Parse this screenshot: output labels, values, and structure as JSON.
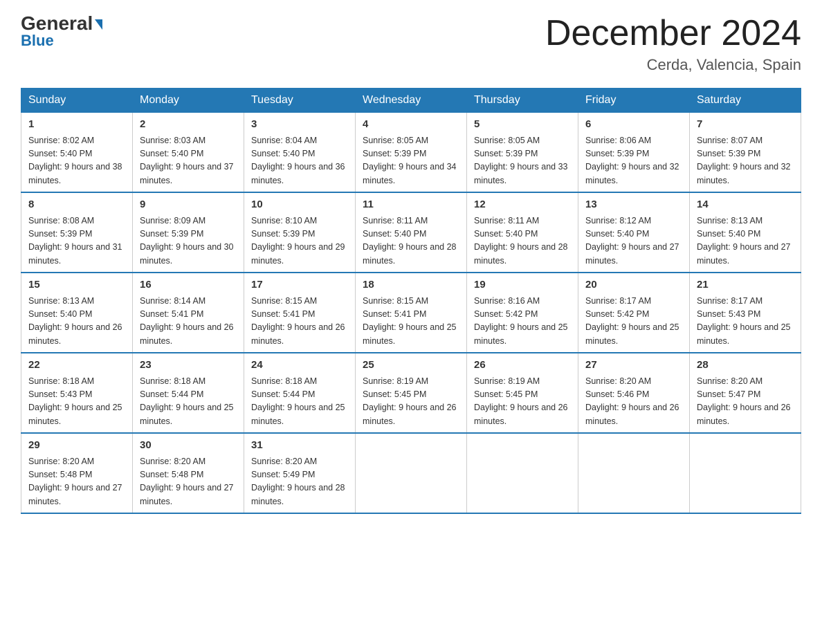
{
  "header": {
    "logo_top": "General",
    "logo_bottom": "Blue",
    "month_title": "December 2024",
    "location": "Cerda, Valencia, Spain"
  },
  "days_of_week": [
    "Sunday",
    "Monday",
    "Tuesday",
    "Wednesday",
    "Thursday",
    "Friday",
    "Saturday"
  ],
  "weeks": [
    [
      {
        "day": "1",
        "sunrise": "Sunrise: 8:02 AM",
        "sunset": "Sunset: 5:40 PM",
        "daylight": "Daylight: 9 hours and 38 minutes."
      },
      {
        "day": "2",
        "sunrise": "Sunrise: 8:03 AM",
        "sunset": "Sunset: 5:40 PM",
        "daylight": "Daylight: 9 hours and 37 minutes."
      },
      {
        "day": "3",
        "sunrise": "Sunrise: 8:04 AM",
        "sunset": "Sunset: 5:40 PM",
        "daylight": "Daylight: 9 hours and 36 minutes."
      },
      {
        "day": "4",
        "sunrise": "Sunrise: 8:05 AM",
        "sunset": "Sunset: 5:39 PM",
        "daylight": "Daylight: 9 hours and 34 minutes."
      },
      {
        "day": "5",
        "sunrise": "Sunrise: 8:05 AM",
        "sunset": "Sunset: 5:39 PM",
        "daylight": "Daylight: 9 hours and 33 minutes."
      },
      {
        "day": "6",
        "sunrise": "Sunrise: 8:06 AM",
        "sunset": "Sunset: 5:39 PM",
        "daylight": "Daylight: 9 hours and 32 minutes."
      },
      {
        "day": "7",
        "sunrise": "Sunrise: 8:07 AM",
        "sunset": "Sunset: 5:39 PM",
        "daylight": "Daylight: 9 hours and 32 minutes."
      }
    ],
    [
      {
        "day": "8",
        "sunrise": "Sunrise: 8:08 AM",
        "sunset": "Sunset: 5:39 PM",
        "daylight": "Daylight: 9 hours and 31 minutes."
      },
      {
        "day": "9",
        "sunrise": "Sunrise: 8:09 AM",
        "sunset": "Sunset: 5:39 PM",
        "daylight": "Daylight: 9 hours and 30 minutes."
      },
      {
        "day": "10",
        "sunrise": "Sunrise: 8:10 AM",
        "sunset": "Sunset: 5:39 PM",
        "daylight": "Daylight: 9 hours and 29 minutes."
      },
      {
        "day": "11",
        "sunrise": "Sunrise: 8:11 AM",
        "sunset": "Sunset: 5:40 PM",
        "daylight": "Daylight: 9 hours and 28 minutes."
      },
      {
        "day": "12",
        "sunrise": "Sunrise: 8:11 AM",
        "sunset": "Sunset: 5:40 PM",
        "daylight": "Daylight: 9 hours and 28 minutes."
      },
      {
        "day": "13",
        "sunrise": "Sunrise: 8:12 AM",
        "sunset": "Sunset: 5:40 PM",
        "daylight": "Daylight: 9 hours and 27 minutes."
      },
      {
        "day": "14",
        "sunrise": "Sunrise: 8:13 AM",
        "sunset": "Sunset: 5:40 PM",
        "daylight": "Daylight: 9 hours and 27 minutes."
      }
    ],
    [
      {
        "day": "15",
        "sunrise": "Sunrise: 8:13 AM",
        "sunset": "Sunset: 5:40 PM",
        "daylight": "Daylight: 9 hours and 26 minutes."
      },
      {
        "day": "16",
        "sunrise": "Sunrise: 8:14 AM",
        "sunset": "Sunset: 5:41 PM",
        "daylight": "Daylight: 9 hours and 26 minutes."
      },
      {
        "day": "17",
        "sunrise": "Sunrise: 8:15 AM",
        "sunset": "Sunset: 5:41 PM",
        "daylight": "Daylight: 9 hours and 26 minutes."
      },
      {
        "day": "18",
        "sunrise": "Sunrise: 8:15 AM",
        "sunset": "Sunset: 5:41 PM",
        "daylight": "Daylight: 9 hours and 25 minutes."
      },
      {
        "day": "19",
        "sunrise": "Sunrise: 8:16 AM",
        "sunset": "Sunset: 5:42 PM",
        "daylight": "Daylight: 9 hours and 25 minutes."
      },
      {
        "day": "20",
        "sunrise": "Sunrise: 8:17 AM",
        "sunset": "Sunset: 5:42 PM",
        "daylight": "Daylight: 9 hours and 25 minutes."
      },
      {
        "day": "21",
        "sunrise": "Sunrise: 8:17 AM",
        "sunset": "Sunset: 5:43 PM",
        "daylight": "Daylight: 9 hours and 25 minutes."
      }
    ],
    [
      {
        "day": "22",
        "sunrise": "Sunrise: 8:18 AM",
        "sunset": "Sunset: 5:43 PM",
        "daylight": "Daylight: 9 hours and 25 minutes."
      },
      {
        "day": "23",
        "sunrise": "Sunrise: 8:18 AM",
        "sunset": "Sunset: 5:44 PM",
        "daylight": "Daylight: 9 hours and 25 minutes."
      },
      {
        "day": "24",
        "sunrise": "Sunrise: 8:18 AM",
        "sunset": "Sunset: 5:44 PM",
        "daylight": "Daylight: 9 hours and 25 minutes."
      },
      {
        "day": "25",
        "sunrise": "Sunrise: 8:19 AM",
        "sunset": "Sunset: 5:45 PM",
        "daylight": "Daylight: 9 hours and 26 minutes."
      },
      {
        "day": "26",
        "sunrise": "Sunrise: 8:19 AM",
        "sunset": "Sunset: 5:45 PM",
        "daylight": "Daylight: 9 hours and 26 minutes."
      },
      {
        "day": "27",
        "sunrise": "Sunrise: 8:20 AM",
        "sunset": "Sunset: 5:46 PM",
        "daylight": "Daylight: 9 hours and 26 minutes."
      },
      {
        "day": "28",
        "sunrise": "Sunrise: 8:20 AM",
        "sunset": "Sunset: 5:47 PM",
        "daylight": "Daylight: 9 hours and 26 minutes."
      }
    ],
    [
      {
        "day": "29",
        "sunrise": "Sunrise: 8:20 AM",
        "sunset": "Sunset: 5:48 PM",
        "daylight": "Daylight: 9 hours and 27 minutes."
      },
      {
        "day": "30",
        "sunrise": "Sunrise: 8:20 AM",
        "sunset": "Sunset: 5:48 PM",
        "daylight": "Daylight: 9 hours and 27 minutes."
      },
      {
        "day": "31",
        "sunrise": "Sunrise: 8:20 AM",
        "sunset": "Sunset: 5:49 PM",
        "daylight": "Daylight: 9 hours and 28 minutes."
      },
      null,
      null,
      null,
      null
    ]
  ]
}
